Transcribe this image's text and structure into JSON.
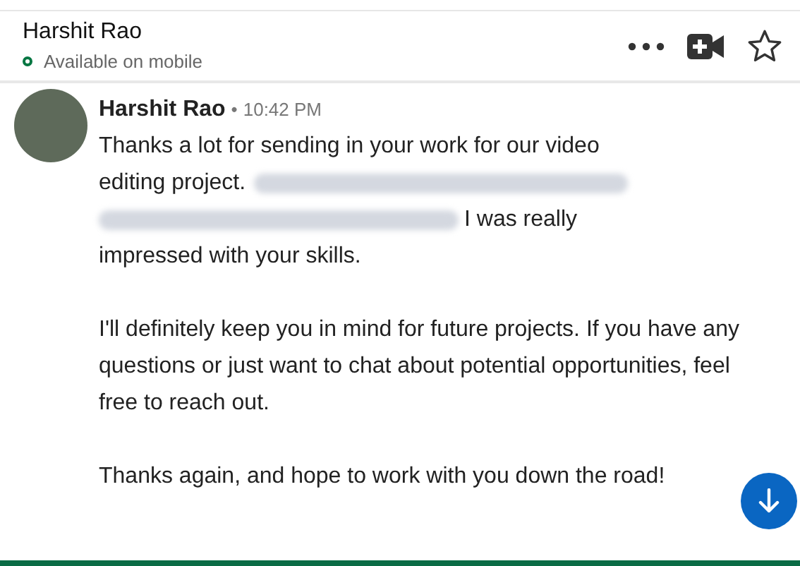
{
  "header": {
    "name": "Harshit Rao",
    "status": "Available on mobile",
    "online": true
  },
  "message": {
    "sender": "Harshit Rao",
    "separator": "•",
    "time": "10:42 PM",
    "paragraphs": [
      {
        "lines": [
          [
            {
              "kind": "text",
              "text": "Thanks a lot for sending in your work for our video"
            }
          ],
          [
            {
              "kind": "text",
              "text": "editing project."
            },
            {
              "kind": "blur"
            }
          ],
          [
            {
              "kind": "blur"
            },
            {
              "kind": "text",
              "text": "I was really"
            }
          ],
          [
            {
              "kind": "text",
              "text": "impressed with your skills."
            }
          ]
        ]
      },
      {
        "lines": [
          [
            {
              "kind": "text",
              "text": "I'll definitely keep you in mind for future projects. If you have any questions or just want to chat about potential opportunities, feel free to reach out."
            }
          ]
        ]
      },
      {
        "lines": [
          [
            {
              "kind": "text",
              "text": "Thanks again, and hope to work with you down the road!"
            }
          ]
        ]
      }
    ]
  }
}
